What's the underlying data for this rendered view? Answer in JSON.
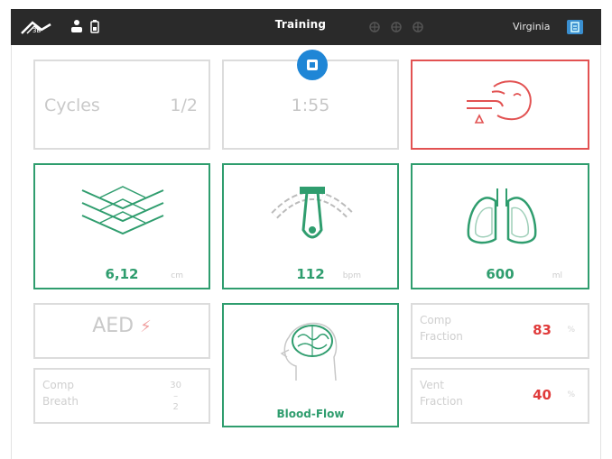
{
  "topbar": {
    "title": "Training",
    "user": "Virginia"
  },
  "cycles": {
    "label": "Cycles",
    "value": "1/2"
  },
  "timer": {
    "value": "1:55"
  },
  "compression": {
    "value": "6,12",
    "unit": "cm"
  },
  "rate": {
    "value": "112",
    "unit": "bpm"
  },
  "ventilation": {
    "value": "600",
    "unit": "ml"
  },
  "aed": {
    "label": "AED"
  },
  "comp_breath": {
    "label_1": "Comp",
    "label_2": "Breath",
    "ratio_top": "30",
    "ratio_bottom": "2"
  },
  "blood_flow": {
    "label": "Blood-Flow"
  },
  "comp_fraction": {
    "label_1": "Comp",
    "label_2": "Fraction",
    "value": "83",
    "unit": "%"
  },
  "vent_fraction": {
    "label_1": "Vent",
    "label_2": "Fraction",
    "value": "40",
    "unit": "%"
  },
  "colors": {
    "accent_green": "#2f9d6e",
    "alert_red": "#e25252",
    "stop_blue": "#1f86d6",
    "topbar": "#2a2a2a"
  },
  "icons": [
    "logo-icon",
    "person-icon",
    "battery-icon",
    "connection-icon",
    "stop-icon",
    "head-airway-icon",
    "compression-layers-icon",
    "rate-gauge-icon",
    "lungs-icon",
    "lightning-icon",
    "brain-head-icon"
  ]
}
